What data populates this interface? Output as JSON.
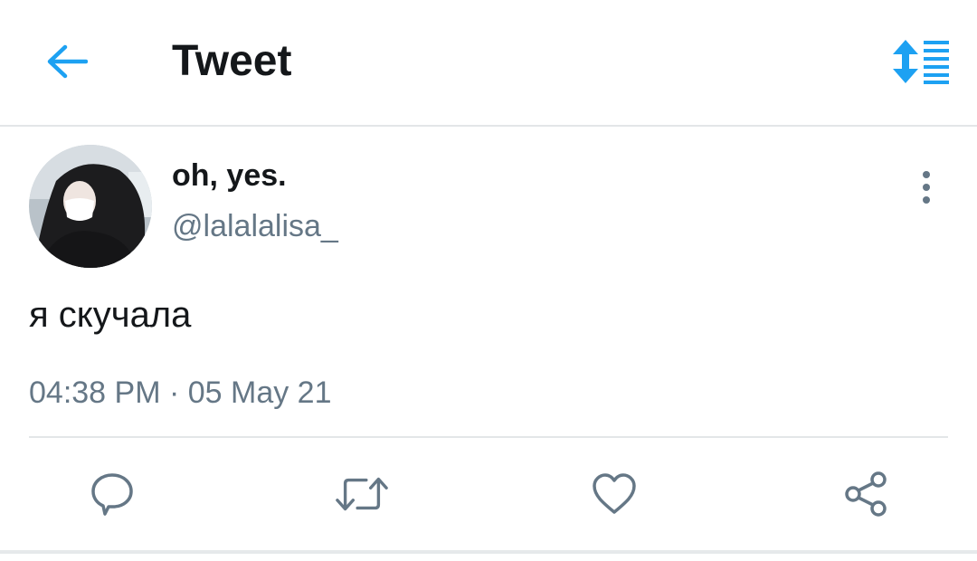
{
  "header": {
    "title": "Tweet",
    "back_icon": "arrow-left-icon",
    "sort_icon": "sort-list-icon"
  },
  "tweet": {
    "display_name": "oh, yes.",
    "handle": "@lalalalisa_",
    "text": "я скучала",
    "timestamp": "04:38 PM · 05 May 21",
    "more_icon": "more-vertical-icon"
  },
  "actions": [
    {
      "icon": "reply-icon"
    },
    {
      "icon": "retweet-icon"
    },
    {
      "icon": "like-icon"
    },
    {
      "icon": "share-icon"
    }
  ],
  "colors": {
    "accent": "#1da1f2",
    "text_primary": "#14171a",
    "text_secondary": "#657786",
    "icon_gray": "#657786",
    "divider": "#e3e6e8"
  }
}
